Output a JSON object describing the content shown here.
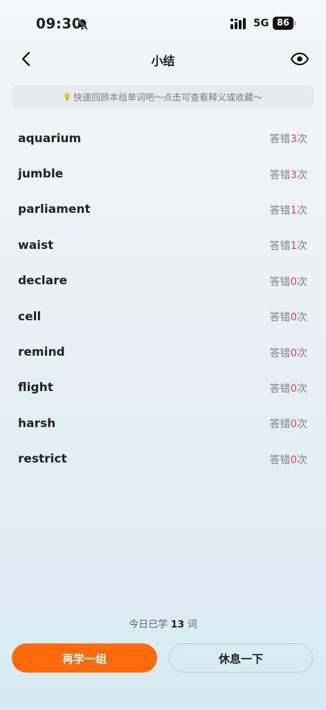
{
  "status_bar": {
    "time": "09:30",
    "network": "5G",
    "battery": "86"
  },
  "header": {
    "title": "小结"
  },
  "tip": {
    "text": "快速回顾本组单词吧～点击可查看释义或收藏～"
  },
  "words": [
    {
      "word": "aquarium",
      "prefix": "答错",
      "count": "3",
      "suffix": "次"
    },
    {
      "word": "jumble",
      "prefix": "答错",
      "count": "3",
      "suffix": "次"
    },
    {
      "word": "parliament",
      "prefix": "答错",
      "count": "1",
      "suffix": "次"
    },
    {
      "word": "waist",
      "prefix": "答错",
      "count": "1",
      "suffix": "次"
    },
    {
      "word": "declare",
      "prefix": "答错",
      "count": "0",
      "suffix": "次"
    },
    {
      "word": "cell",
      "prefix": "答错",
      "count": "0",
      "suffix": "次"
    },
    {
      "word": "remind",
      "prefix": "答错",
      "count": "0",
      "suffix": "次"
    },
    {
      "word": "flight",
      "prefix": "答错",
      "count": "0",
      "suffix": "次"
    },
    {
      "word": "harsh",
      "prefix": "答错",
      "count": "0",
      "suffix": "次"
    },
    {
      "word": "restrict",
      "prefix": "答错",
      "count": "0",
      "suffix": "次"
    }
  ],
  "footer": {
    "today_prefix": "今日已学",
    "today_count": "13",
    "today_suffix": "词",
    "primary_button": "再学一组",
    "secondary_button": "休息一下"
  },
  "colors": {
    "accent": "#ff6a0b",
    "error_count": "#e5484d"
  }
}
